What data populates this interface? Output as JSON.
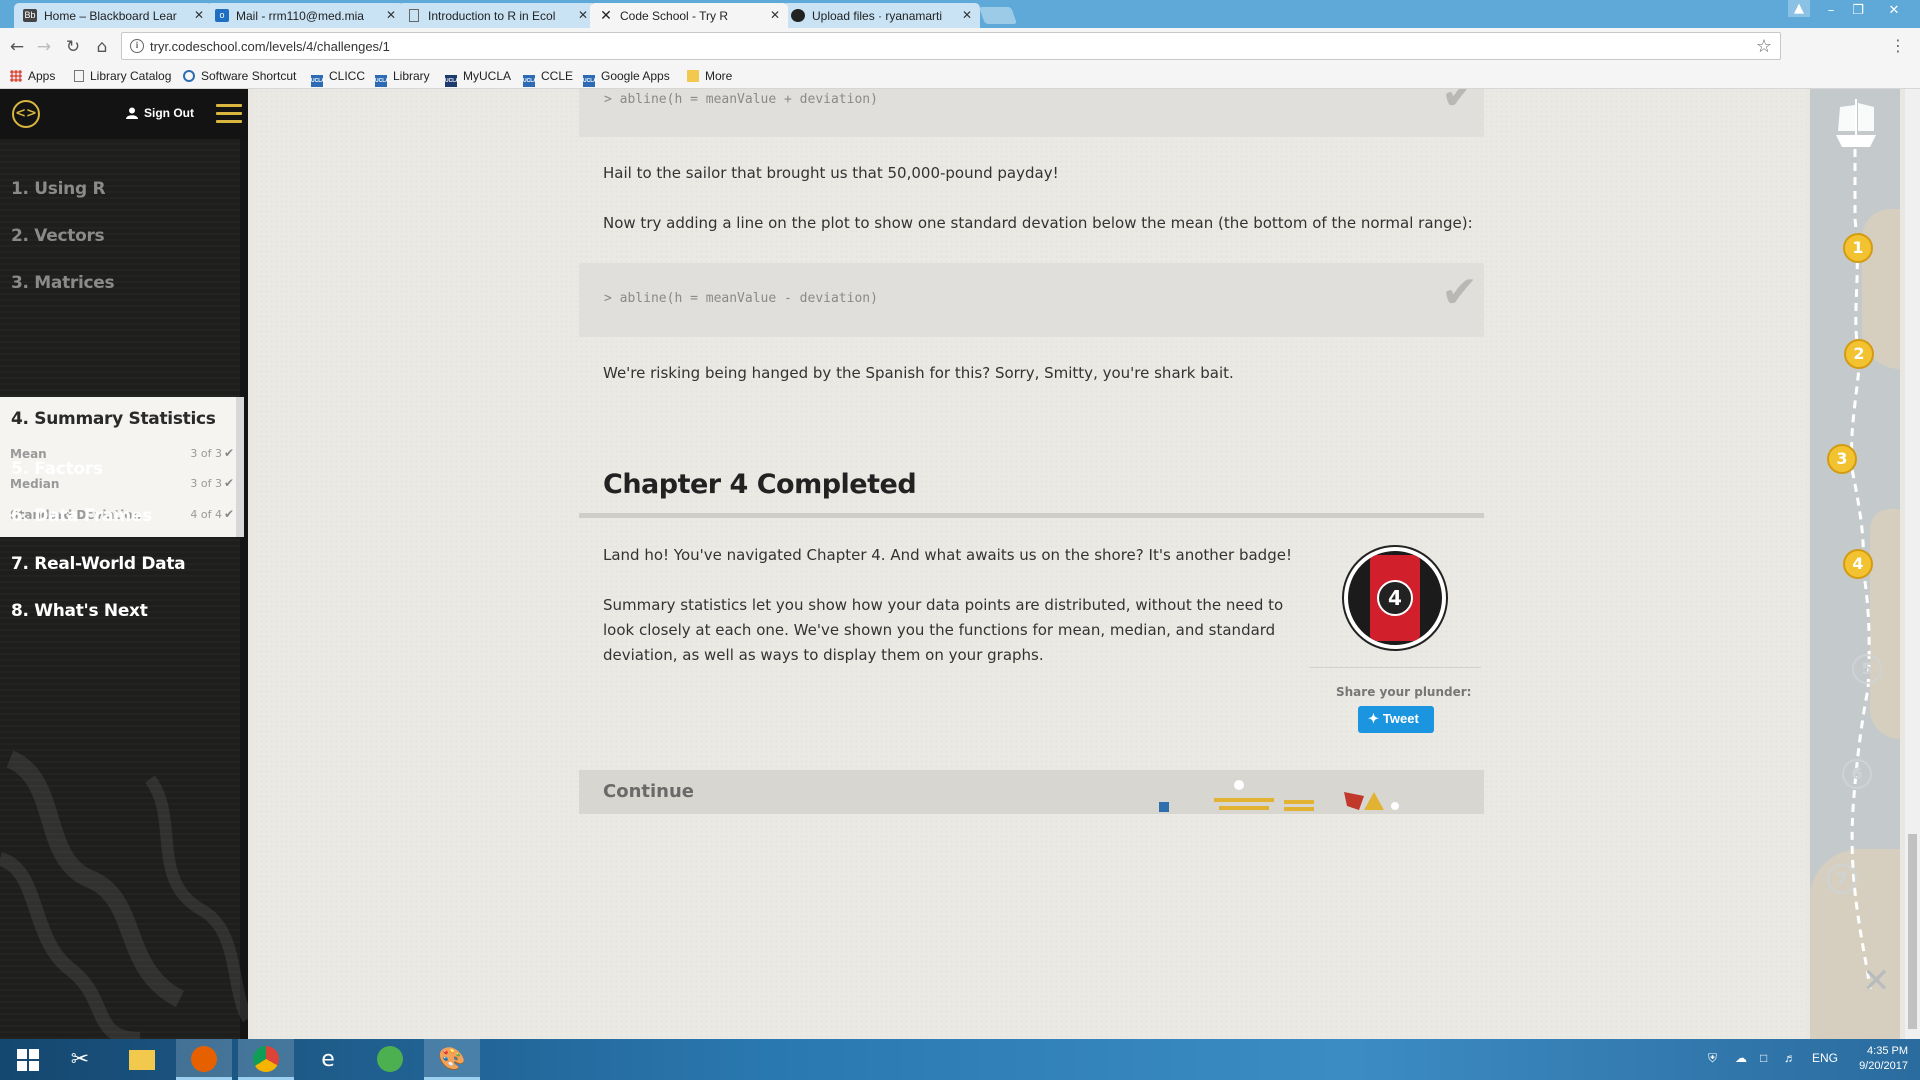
{
  "browser": {
    "tabs": [
      {
        "title": "Home – Blackboard Lear",
        "icon": "blackboard-icon"
      },
      {
        "title": "Mail - rrm110@med.mia",
        "icon": "outlook-icon"
      },
      {
        "title": "Introduction to R in Ecol",
        "icon": "document-icon"
      },
      {
        "title": "Code School - Try R",
        "icon": "codeschool-icon"
      },
      {
        "title": "Upload files · ryanamarti",
        "icon": "github-icon"
      }
    ],
    "url": "tryr.codeschool.com/levels/4/challenges/1",
    "bookmarks": [
      {
        "label": "Apps",
        "icon": "apps-grid-icon"
      },
      {
        "label": "Library Catalog",
        "icon": "page-icon"
      },
      {
        "label": "Software Shortcut",
        "icon": "software-icon"
      },
      {
        "label": "CLICC",
        "icon": "ucla-icon"
      },
      {
        "label": "Library",
        "icon": "ucla-icon"
      },
      {
        "label": "MyUCLA",
        "icon": "ucla-icon"
      },
      {
        "label": "CCLE",
        "icon": "ucla-icon"
      },
      {
        "label": "Google Apps",
        "icon": "ucla-icon"
      },
      {
        "label": "More",
        "icon": "folder-icon"
      }
    ]
  },
  "sidebar": {
    "sign_out": "Sign Out",
    "levels": [
      {
        "label": "1. Using R"
      },
      {
        "label": "2. Vectors"
      },
      {
        "label": "3. Matrices"
      },
      {
        "label": "4. Summary Statistics"
      },
      {
        "label": "5. Factors"
      },
      {
        "label": "6. Data Frames"
      },
      {
        "label": "7. Real-World Data"
      },
      {
        "label": "8. What's Next"
      }
    ],
    "active_subitems": [
      {
        "label": "Mean",
        "progress": "3 of 3"
      },
      {
        "label": "Median",
        "progress": "3 of 3"
      },
      {
        "label": "Standard Deviation",
        "progress": "4 of 4"
      }
    ]
  },
  "content": {
    "code1": "> abline(h = meanValue + deviation)",
    "para1": "Hail to the sailor that brought us that 50,000-pound payday!",
    "para2": "Now try adding a line on the plot to show one standard devation below the mean (the bottom of the normal range):",
    "code2": "> abline(h = meanValue - deviation)",
    "para3": "We're risking being hanged by the Spanish for this? Sorry, Smitty, you're shark bait.",
    "chapter_title": "Chapter 4 Completed",
    "chapter_p1": "Land ho! You've navigated Chapter 4. And what awaits us on the shore? It's another badge!",
    "chapter_p2_l1": "Summary statistics let you show how your data points are distributed, without the need to",
    "chapter_p2_l2": "look closely at each one. We've shown you the functions for mean, median, and standard",
    "chapter_p2_l3": "deviation, as well as ways to display them on your graphs.",
    "badge_number": "4",
    "share_label": "Share your plunder:",
    "tweet_label": "Tweet",
    "continue_label": "Continue"
  },
  "map": {
    "waypoints": [
      "1",
      "2",
      "3",
      "4",
      "5",
      "6",
      "7"
    ],
    "completed": 4
  },
  "taskbar": {
    "language": "ENG",
    "time": "4:35 PM",
    "date": "9/20/2017"
  },
  "colors": {
    "accent_gold": "#d8b640",
    "sidebar_bg": "#1e1e1d",
    "badge_red": "#d21f2c",
    "tweet_blue": "#1b95e0"
  }
}
